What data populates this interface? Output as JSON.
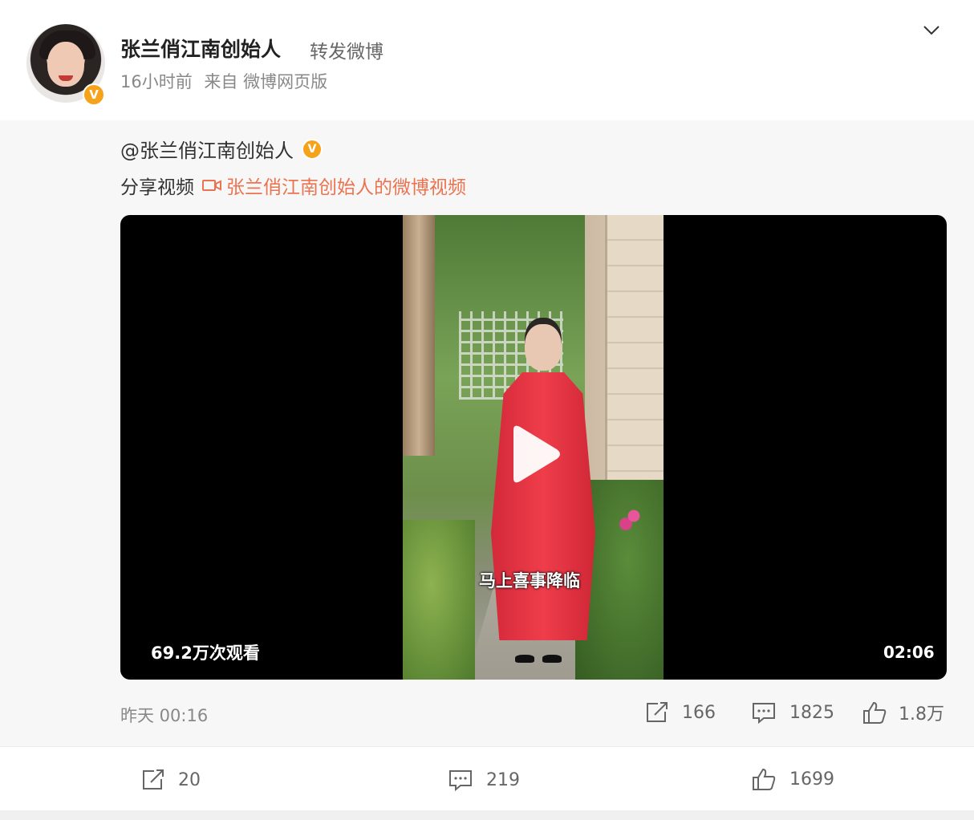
{
  "post": {
    "author_name": "张兰俏江南创始人",
    "action": "转发微博",
    "time": "16小时前",
    "source": "来自 微博网页版"
  },
  "original": {
    "author": "@张兰俏江南创始人",
    "share_prefix": "分享视频",
    "video_link": "张兰俏江南创始人的微博视频",
    "video": {
      "subtitle": "马上喜事降临",
      "views": "69.2万次观看",
      "duration": "02:06"
    },
    "time": "昨天 00:16",
    "stats": {
      "reposts": "166",
      "comments": "1825",
      "likes": "1.8万"
    }
  },
  "actions": {
    "reposts": "20",
    "comments": "219",
    "likes": "1699"
  },
  "colors": {
    "link": "#eb7350",
    "verified_badge": "#f7a21b"
  },
  "icons": {
    "verified": "V",
    "menu": "chevron-down-icon",
    "repost": "repost-icon",
    "comment": "comment-icon",
    "like": "like-icon",
    "video": "video-icon",
    "play": "play-icon"
  }
}
